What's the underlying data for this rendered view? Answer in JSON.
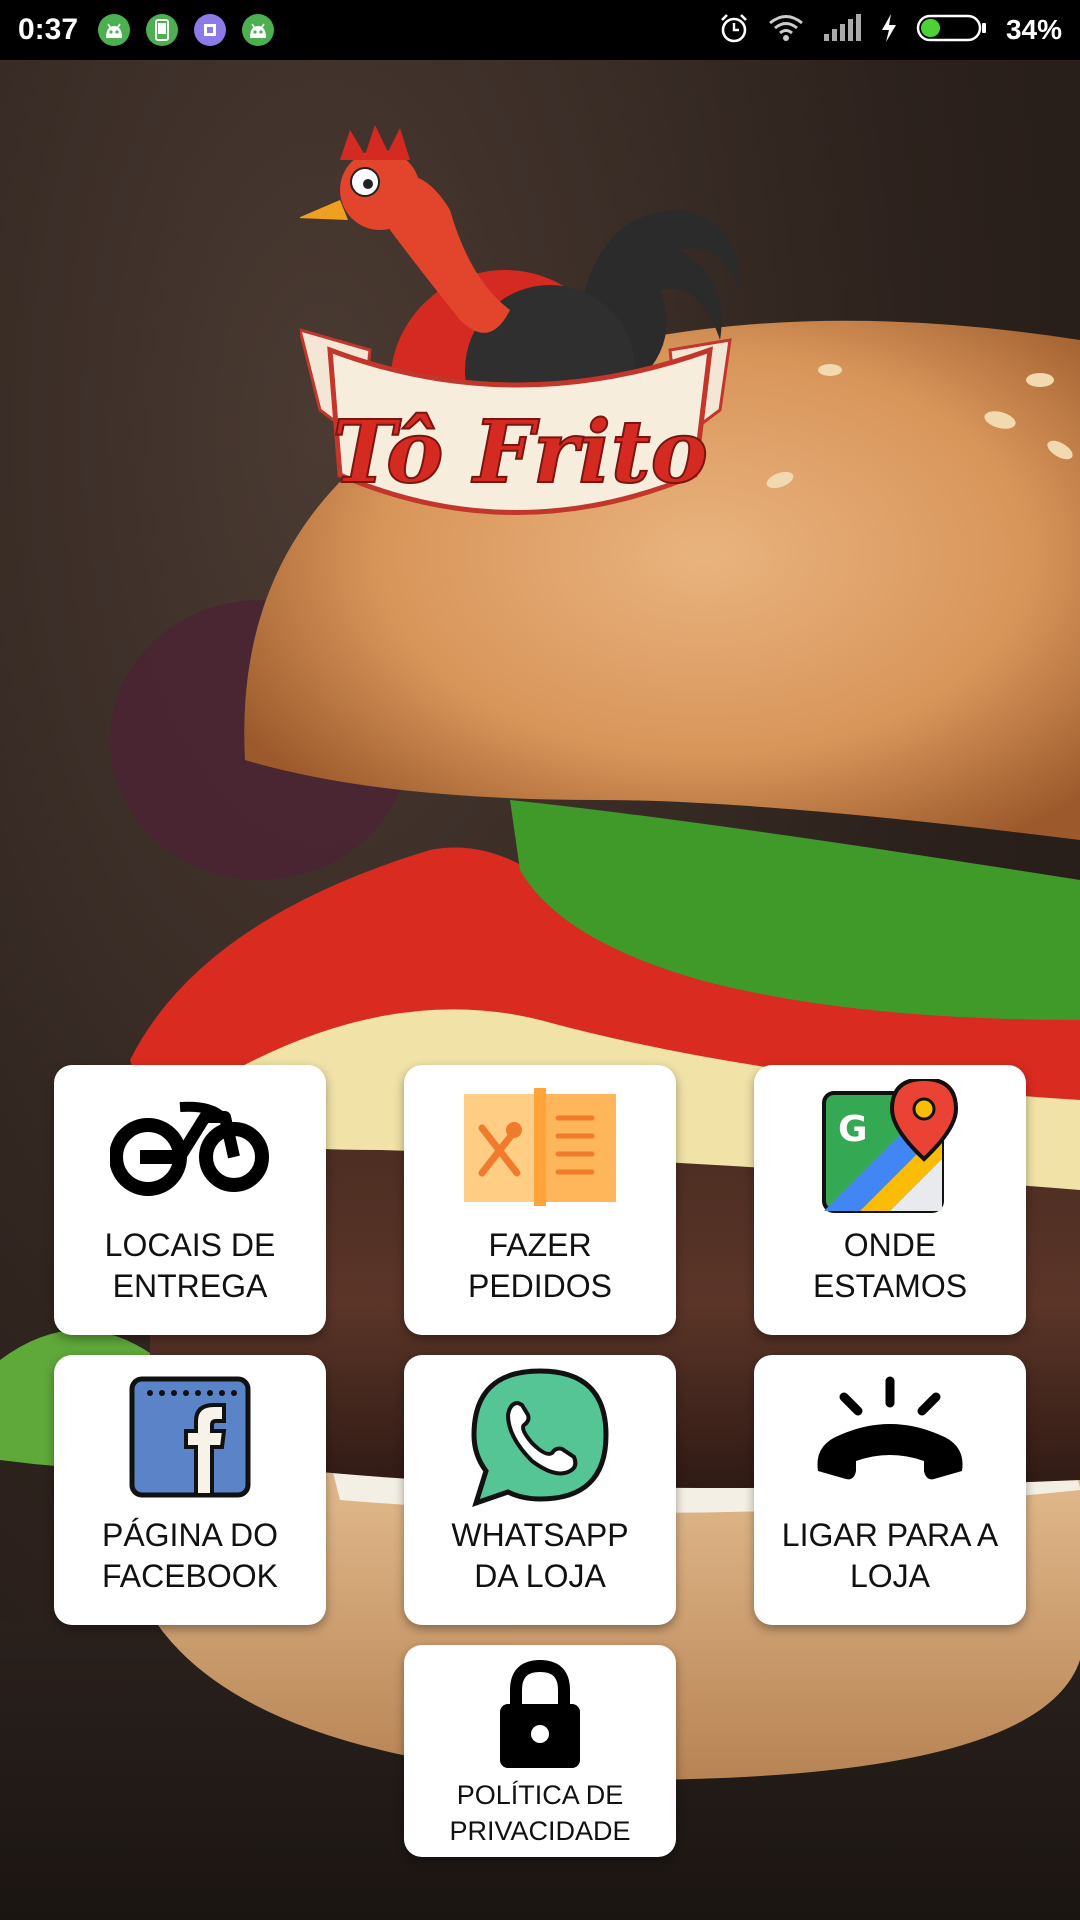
{
  "status_bar": {
    "time": "0:37",
    "battery_percent": "34%",
    "battery_level": 0.34,
    "notification_icons": [
      "android-icon",
      "phone-icon",
      "app-icon",
      "android-icon"
    ],
    "right_icons": [
      "alarm-icon",
      "wifi-icon",
      "signal-icon",
      "charging-icon",
      "battery-icon"
    ]
  },
  "logo": {
    "brand_text": "Tô Frito"
  },
  "menu": {
    "tiles": [
      {
        "label": "LOCAIS DE\nENTREGA",
        "icon": "motorcycle-icon"
      },
      {
        "label": "FAZER\nPEDIDOS",
        "icon": "menu-book-icon"
      },
      {
        "label": "ONDE\nESTAMOS",
        "icon": "google-maps-icon"
      },
      {
        "label": "PÁGINA DO\nFACEBOOK",
        "icon": "facebook-icon"
      },
      {
        "label": "WHATSAPP\nDA LOJA",
        "icon": "whatsapp-icon"
      },
      {
        "label": "LIGAR PARA A\nLOJA",
        "icon": "phone-call-icon"
      },
      {
        "label": "POLÍTICA DE\nPRIVACIDADE",
        "icon": "lock-icon"
      }
    ]
  },
  "colors": {
    "status_bar_bg": "#000000",
    "tile_bg": "#ffffff",
    "brand_red": "#d42a22",
    "facebook_blue": "#5b83c7",
    "whatsapp_green": "#56c596",
    "battery_green": "#4cd137"
  }
}
